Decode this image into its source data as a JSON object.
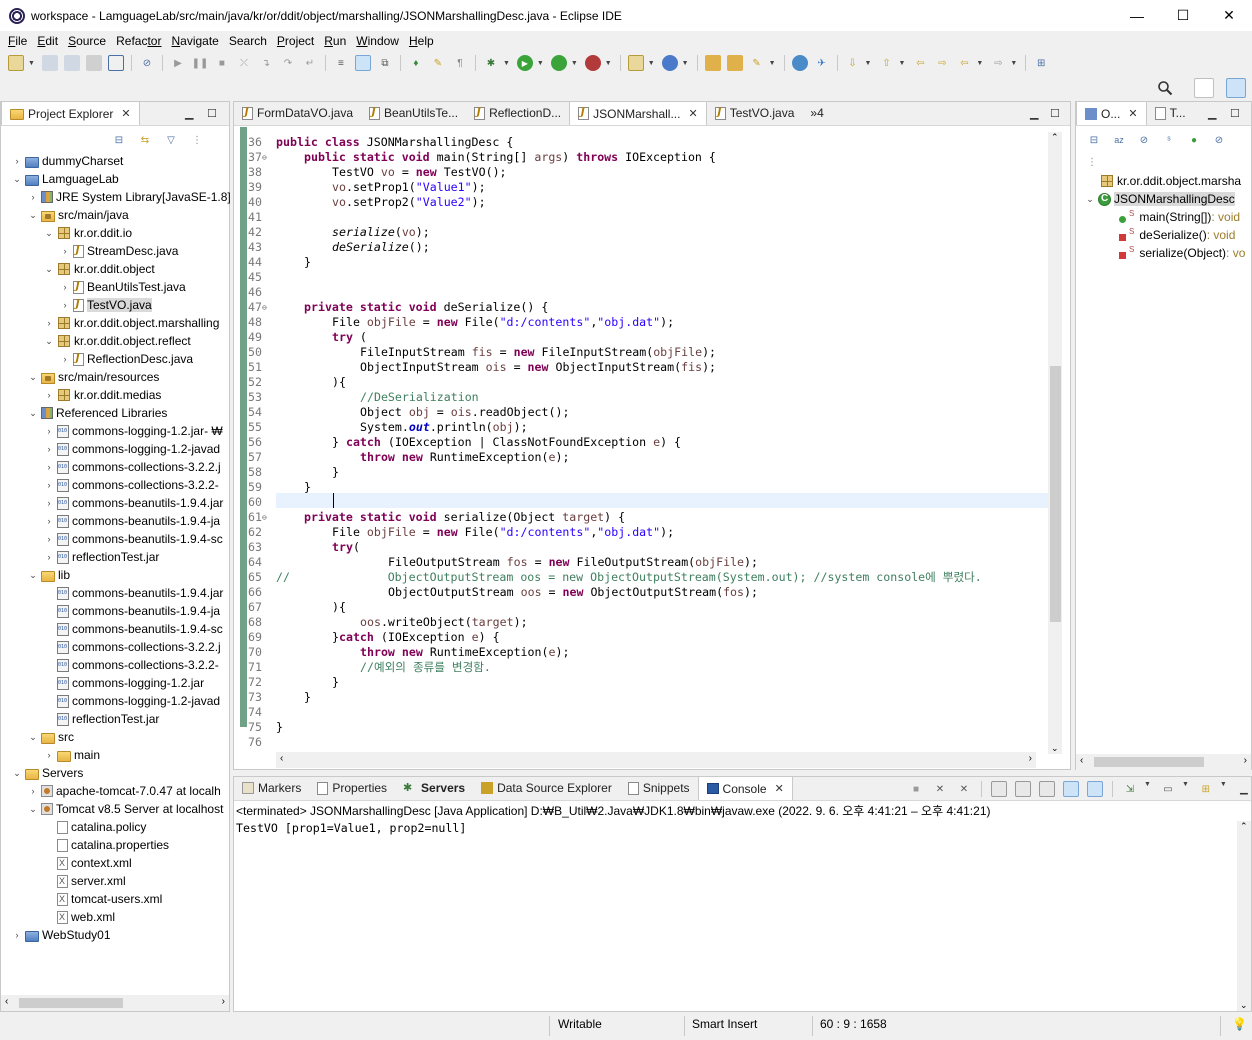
{
  "window": {
    "title": "workspace - LamguageLab/src/main/java/kr/or/ddit/object/marshalling/JSONMarshallingDesc.java - Eclipse IDE",
    "minimize": "—",
    "maximize": "☐",
    "close": "✕"
  },
  "menu": [
    {
      "key": "F",
      "rest": "ile"
    },
    {
      "key": "E",
      "rest": "dit"
    },
    {
      "key": "S",
      "rest": "ource"
    },
    {
      "key": "Refac",
      "rest": "tor"
    },
    {
      "key": "N",
      "rest": "avigate"
    },
    {
      "key": "Se",
      "rest": "arch"
    },
    {
      "key": "P",
      "rest": "roject"
    },
    {
      "key": "R",
      "rest": "un"
    },
    {
      "key": "W",
      "rest": "indow"
    },
    {
      "key": "H",
      "rest": "elp"
    }
  ],
  "project_explorer": {
    "tab_label": "Project Explorer",
    "items": [
      {
        "label": "dummyCharset",
        "dim": ""
      },
      {
        "label": "LamguageLab",
        "dim": ""
      },
      {
        "label": "JRE System Library",
        "dim": " [JavaSE-1.8]"
      },
      {
        "label": "src/main/java",
        "dim": ""
      },
      {
        "label": "kr.or.ddit.io",
        "dim": ""
      },
      {
        "label": "StreamDesc.java",
        "dim": ""
      },
      {
        "label": "kr.or.ddit.object",
        "dim": ""
      },
      {
        "label": "BeanUtilsTest.java",
        "dim": ""
      },
      {
        "label": "TestVO.java",
        "dim": ""
      },
      {
        "label": "kr.or.ddit.object.marshalling",
        "dim": ""
      },
      {
        "label": "kr.or.ddit.object.reflect",
        "dim": ""
      },
      {
        "label": "ReflectionDesc.java",
        "dim": ""
      },
      {
        "label": "src/main/resources",
        "dim": ""
      },
      {
        "label": "kr.or.ddit.medias",
        "dim": ""
      },
      {
        "label": "Referenced Libraries",
        "dim": ""
      },
      {
        "label": "commons-logging-1.2.jar",
        "dim": " - ₩"
      },
      {
        "label": "commons-logging-1.2-javad",
        "dim": ""
      },
      {
        "label": "commons-collections-3.2.2.j",
        "dim": ""
      },
      {
        "label": "commons-collections-3.2.2-",
        "dim": ""
      },
      {
        "label": "commons-beanutils-1.9.4.jar",
        "dim": ""
      },
      {
        "label": "commons-beanutils-1.9.4-ja",
        "dim": ""
      },
      {
        "label": "commons-beanutils-1.9.4-sc",
        "dim": ""
      },
      {
        "label": "reflectionTest.jar",
        "dim": ""
      },
      {
        "label": "lib",
        "dim": ""
      },
      {
        "label": "commons-beanutils-1.9.4.jar",
        "dim": ""
      },
      {
        "label": "commons-beanutils-1.9.4-ja",
        "dim": ""
      },
      {
        "label": "commons-beanutils-1.9.4-sc",
        "dim": ""
      },
      {
        "label": "commons-collections-3.2.2.j",
        "dim": ""
      },
      {
        "label": "commons-collections-3.2.2-",
        "dim": ""
      },
      {
        "label": "commons-logging-1.2.jar",
        "dim": ""
      },
      {
        "label": "commons-logging-1.2-javad",
        "dim": ""
      },
      {
        "label": "reflectionTest.jar",
        "dim": ""
      },
      {
        "label": "src",
        "dim": ""
      },
      {
        "label": "main",
        "dim": ""
      },
      {
        "label": "Servers",
        "dim": ""
      },
      {
        "label": "apache-tomcat-7.0.47 at localh",
        "dim": ""
      },
      {
        "label": "Tomcat v8.5 Server at localhost",
        "dim": ""
      },
      {
        "label": "catalina.policy",
        "dim": ""
      },
      {
        "label": "catalina.properties",
        "dim": ""
      },
      {
        "label": "context.xml",
        "dim": ""
      },
      {
        "label": "server.xml",
        "dim": ""
      },
      {
        "label": "tomcat-users.xml",
        "dim": ""
      },
      {
        "label": "web.xml",
        "dim": ""
      },
      {
        "label": "WebStudy01",
        "dim": ""
      }
    ]
  },
  "editor": {
    "tabs": [
      "FormDataVO.java",
      "BeanUtilsTe...",
      "ReflectionD...",
      "JSONMarshall...",
      "TestVO.java"
    ],
    "overflow": "»4",
    "line_numbers": [
      "36",
      "37",
      "38",
      "39",
      "40",
      "41",
      "42",
      "43",
      "44",
      "45",
      "46",
      "47",
      "48",
      "49",
      "50",
      "51",
      "52",
      "53",
      "54",
      "55",
      "56",
      "57",
      "58",
      "59",
      "60",
      "61",
      "62",
      "63",
      "64",
      "65",
      "66",
      "67",
      "68",
      "69",
      "70",
      "71",
      "72",
      "73",
      "74",
      "75",
      "76"
    ],
    "code": {
      "l36a": "public class ",
      "l36b": "JSONMarshallingDesc {",
      "l37a": "public static void ",
      "l37b": "main(String[] ",
      "l37c": "args",
      "l37d": ") ",
      "l37e": "throws ",
      "l37f": "IOException {",
      "l38a": "TestVO ",
      "l38b": "vo",
      "l38c": " = ",
      "l38d": "new ",
      "l38e": "TestVO();",
      "l39a": "vo",
      "l39b": ".setProp1(",
      "l39c": "\"Value1\"",
      "l39d": ");",
      "l40a": "vo",
      "l40b": ".setProp2(",
      "l40c": "\"Value2\"",
      "l40d": ");",
      "l42a": "serialize",
      "l42b": "(",
      "l42c": "vo",
      "l42d": ");",
      "l43a": "deSerialize",
      "l43b": "();",
      "l44": "}",
      "l47a": "private static void ",
      "l47b": "deSerialize() {",
      "l48a": "File ",
      "l48b": "objFile",
      "l48c": " = ",
      "l48d": "new ",
      "l48e": "File(",
      "l48f": "\"d:/contents\"",
      "l48g": ",",
      "l48h": "\"obj.dat\"",
      "l48i": ");",
      "l49a": "try ",
      "l49b": "(",
      "l50a": "FileInputStream ",
      "l50b": "fis",
      "l50c": " = ",
      "l50d": "new ",
      "l50e": "FileInputStream(",
      "l50f": "objFile",
      "l50g": ");",
      "l51a": "ObjectInputStream ",
      "l51b": "ois",
      "l51c": " = ",
      "l51d": "new ",
      "l51e": "ObjectInputStream(",
      "l51f": "fis",
      "l51g": ");",
      "l52": "){",
      "l53": "//DeSerialization",
      "l54a": "Object ",
      "l54b": "obj",
      "l54c": " = ",
      "l54d": "ois",
      "l54e": ".readObject();",
      "l55a": "System.",
      "l55b": "out",
      "l55c": ".println(",
      "l55d": "obj",
      "l55e": ");",
      "l56a": "} ",
      "l56b": "catch ",
      "l56c": "(IOException | ClassNotFoundException ",
      "l56d": "e",
      "l56e": ") {",
      "l57a": "throw ",
      "l57b": "new ",
      "l57c": "RuntimeException(",
      "l57d": "e",
      "l57e": ");",
      "l58": "}",
      "l59": "}",
      "l61a": "private static void ",
      "l61b": "serialize(Object ",
      "l61c": "target",
      "l61d": ") {",
      "l62a": "File ",
      "l62b": "objFile",
      "l62c": " = ",
      "l62d": "new ",
      "l62e": "File(",
      "l62f": "\"d:/contents\"",
      "l62g": ",",
      "l62h": "\"obj.dat\"",
      "l62i": ");",
      "l63a": "try",
      "l63b": "(",
      "l64a": "FileOutputStream ",
      "l64b": "fos",
      "l64c": " = ",
      "l64d": "new ",
      "l64e": "FileOutputStream(",
      "l64f": "objFile",
      "l64g": ");",
      "l65a": "//",
      "l65b": "ObjectOutputStream oos = new ObjectOutputStream(System.out); //system console에 뿌렸다.",
      "l66a": "ObjectOutputStream ",
      "l66b": "oos",
      "l66c": " = ",
      "l66d": "new ",
      "l66e": "ObjectOutputStream(",
      "l66f": "fos",
      "l66g": ");",
      "l67": "){",
      "l68a": "oos",
      "l68b": ".writeObject(",
      "l68c": "target",
      "l68d": ");",
      "l69a": "}",
      "l69b": "catch ",
      "l69c": "(IOException ",
      "l69d": "e",
      "l69e": ") {",
      "l70a": "throw ",
      "l70b": "new ",
      "l70c": "RuntimeException(",
      "l70d": "e",
      "l70e": ");",
      "l71": "//예외의 종류를 변경함.",
      "l72": "}",
      "l73": "}",
      "l75": "}"
    }
  },
  "outline": {
    "tab1": "O...",
    "tab2": "T...",
    "items": [
      {
        "label": "kr.or.ddit.object.marsha",
        "suffix": ""
      },
      {
        "label": "JSONMarshallingDesc",
        "suffix": ""
      },
      {
        "label": "main(String[])",
        "suffix": " : void"
      },
      {
        "label": "deSerialize()",
        "suffix": " : void"
      },
      {
        "label": "serialize(Object)",
        "suffix": " : vo"
      }
    ]
  },
  "bottom": {
    "tabs": [
      "Markers",
      "Properties",
      "Servers",
      "Data Source Explorer",
      "Snippets",
      "Console"
    ],
    "terminated": "<terminated> JSONMarshallingDesc [Java Application] D:₩B_Util₩2.Java₩JDK1.8₩bin₩javaw.exe  (2022. 9. 6. 오후 4:41:21 – 오후 4:41:21)",
    "output": "TestVO [prop1=Value1, prop2=null]"
  },
  "status": {
    "writable": "Writable",
    "insert_mode": "Smart Insert",
    "position": "60 : 9 : 1658"
  }
}
